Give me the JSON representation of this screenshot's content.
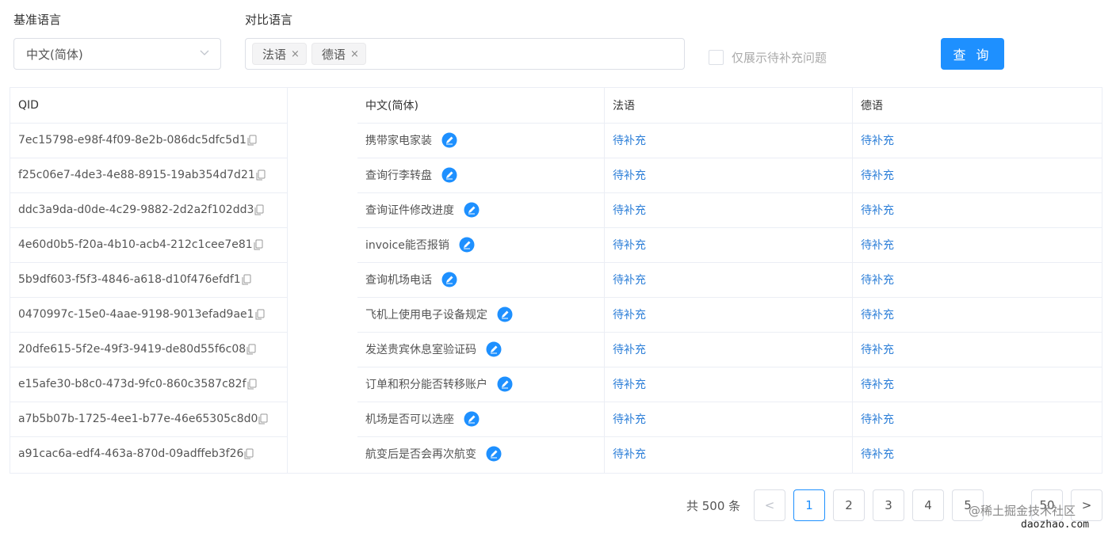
{
  "filters": {
    "base_label": "基准语言",
    "compare_label": "对比语言",
    "base_selected": "中文(简体)",
    "compare_tags": [
      "法语",
      "德语"
    ],
    "tag_close": "×",
    "checkbox_label": "仅展示待补充问题",
    "checkbox_checked": false,
    "query_button": "查 询"
  },
  "table": {
    "headers": {
      "qid": "QID",
      "zh": "中文(简体)",
      "fr": "法语",
      "de": "德语"
    },
    "rows": [
      {
        "qid": "7ec15798-e98f-4f09-8e2b-086dc5dfc5d1",
        "zh": "携带家电家装",
        "fr": "待补充",
        "de": "待补充"
      },
      {
        "qid": "f25c06e7-4de3-4e88-8915-19ab354d7d21",
        "zh": "查询行李转盘",
        "fr": "待补充",
        "de": "待补充"
      },
      {
        "qid": "ddc3a9da-d0de-4c29-9882-2d2a2f102dd3",
        "zh": "查询证件修改进度",
        "fr": "待补充",
        "de": "待补充"
      },
      {
        "qid": "4e60d0b5-f20a-4b10-acb4-212c1cee7e81",
        "zh": "invoice能否报销",
        "fr": "待补充",
        "de": "待补充"
      },
      {
        "qid": "5b9df603-f5f3-4846-a618-d10f476efdf1",
        "zh": "查询机场电话",
        "fr": "待补充",
        "de": "待补充"
      },
      {
        "qid": "0470997c-15e0-4aae-9198-9013efad9ae1",
        "zh": "飞机上使用电子设备规定",
        "fr": "待补充",
        "de": "待补充"
      },
      {
        "qid": "20dfe615-5f2e-49f3-9419-de80d55f6c08",
        "zh": "发送贵宾休息室验证码",
        "fr": "待补充",
        "de": "待补充"
      },
      {
        "qid": "e15afe30-b8c0-473d-9fc0-860c3587c82f",
        "zh": "订单和积分能否转移账户",
        "fr": "待补充",
        "de": "待补充"
      },
      {
        "qid": "a7b5b07b-1725-4ee1-b77e-46e65305c8d0",
        "zh": "机场是否可以选座",
        "fr": "待补充",
        "de": "待补充"
      },
      {
        "qid": "a91cac6a-edf4-463a-870d-09adffeb3f26",
        "zh": "航变后是否会再次航变",
        "fr": "待补充",
        "de": "待补充"
      }
    ]
  },
  "pagination": {
    "total": "共 500 条",
    "prev": "<",
    "pages": [
      "1",
      "2",
      "3",
      "4",
      "5"
    ],
    "last": "50",
    "next": ">",
    "current": "1"
  },
  "watermark": {
    "line1": "@稀土掘金技术社区",
    "line2": "daozhao.com"
  },
  "colors": {
    "primary": "#1e90ff",
    "link": "#2d7fd8",
    "border": "#dcdfe6"
  },
  "icons": {
    "copy": "copy-icon",
    "edit": "edit-icon",
    "dropdown": "chevron-down-icon"
  }
}
